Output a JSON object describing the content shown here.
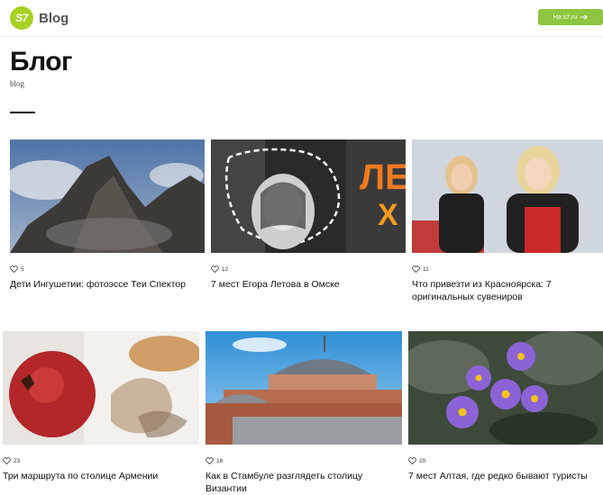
{
  "header": {
    "logo_mark": "S7",
    "logo_text": "Blog",
    "cta_label": "На s7.ru",
    "cta_icon": "arrow-right-icon"
  },
  "page": {
    "title": "Блог",
    "subtitle": "blog"
  },
  "colors": {
    "brand": "#a7d223",
    "cta": "#8dc63f"
  },
  "cards": [
    {
      "likes": "5",
      "title": "Дети Ингушетии: фотоэссе Теи Спектор",
      "image": "mountain-clouds-photo"
    },
    {
      "likes": "12",
      "title": "7 мест Егора Летова в Омске",
      "image": "collage-portrait-photo"
    },
    {
      "likes": "11",
      "title": "Что привезти из Красноярска: 7 оригинальных сувениров",
      "image": "two-girls-photo"
    },
    {
      "likes": "23",
      "title": "Три маршрута по столице Армении",
      "image": "pomegranate-photo"
    },
    {
      "likes": "16",
      "title": "Как в Стамбуле разглядеть столицу Византии",
      "image": "hagia-sophia-photo"
    },
    {
      "likes": "20",
      "title": "7 мест Алтая, где редко бывают туристы",
      "image": "purple-flowers-photo"
    }
  ]
}
